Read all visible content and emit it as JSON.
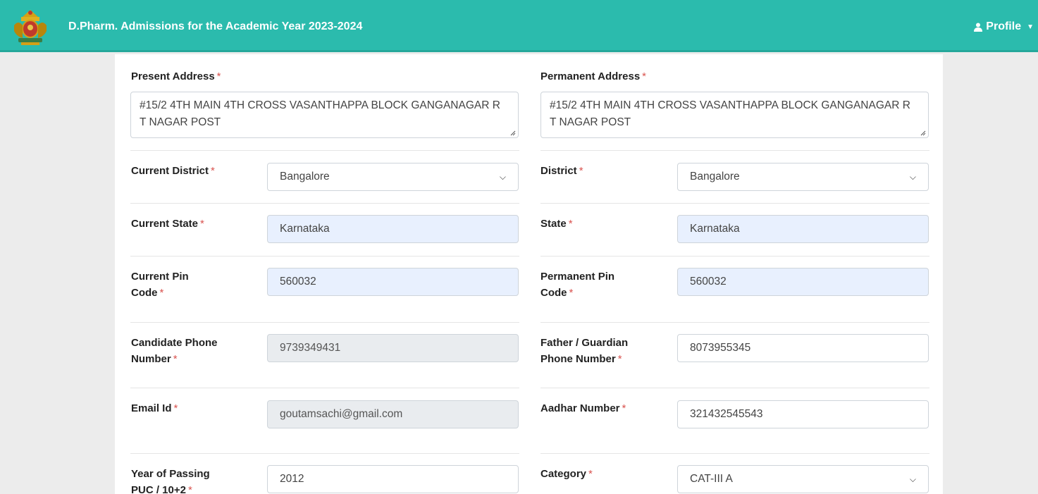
{
  "header": {
    "title": "D.Pharm. Admissions for the Academic Year 2023-2024",
    "profile_label": "Profile",
    "profile_icon": "user-icon",
    "caret_icon": "caret-down-icon",
    "bg_color": "#2bbbad"
  },
  "form": {
    "present_address": {
      "label": "Present Address",
      "value": "#15/2 4TH MAIN 4TH CROSS VASANTHAPPA BLOCK GANGANAGAR R T NAGAR POST"
    },
    "permanent_address": {
      "label": "Permanent Address",
      "value": "#15/2 4TH MAIN 4TH CROSS VASANTHAPPA BLOCK GANGANAGAR R T NAGAR POST"
    },
    "current_district": {
      "label": "Current District",
      "value": "Bangalore"
    },
    "district": {
      "label": "District",
      "value": "Bangalore"
    },
    "current_state": {
      "label": "Current State",
      "value": "Karnataka"
    },
    "state": {
      "label": "State",
      "value": "Karnataka"
    },
    "current_pin": {
      "label_line1": "Current Pin",
      "label_line2": "Code",
      "value": "560032"
    },
    "permanent_pin": {
      "label_line1": "Permanent Pin",
      "label_line2": "Code",
      "value": "560032"
    },
    "candidate_phone": {
      "label_line1": "Candidate Phone",
      "label_line2": "Number",
      "value": "9739349431"
    },
    "guardian_phone": {
      "label_line1": "Father / Guardian",
      "label_line2": "Phone Number",
      "value": "8073955345"
    },
    "email": {
      "label": "Email Id",
      "value": "goutamsachi@gmail.com"
    },
    "aadhar": {
      "label": "Aadhar Number",
      "value": "321432545543"
    },
    "puc_year": {
      "label_line1": "Year of Passing",
      "label_line2": "PUC / 10+2",
      "value": "2012"
    },
    "category": {
      "label": "Category",
      "value": "CAT-III A"
    },
    "required_mark": "*"
  }
}
